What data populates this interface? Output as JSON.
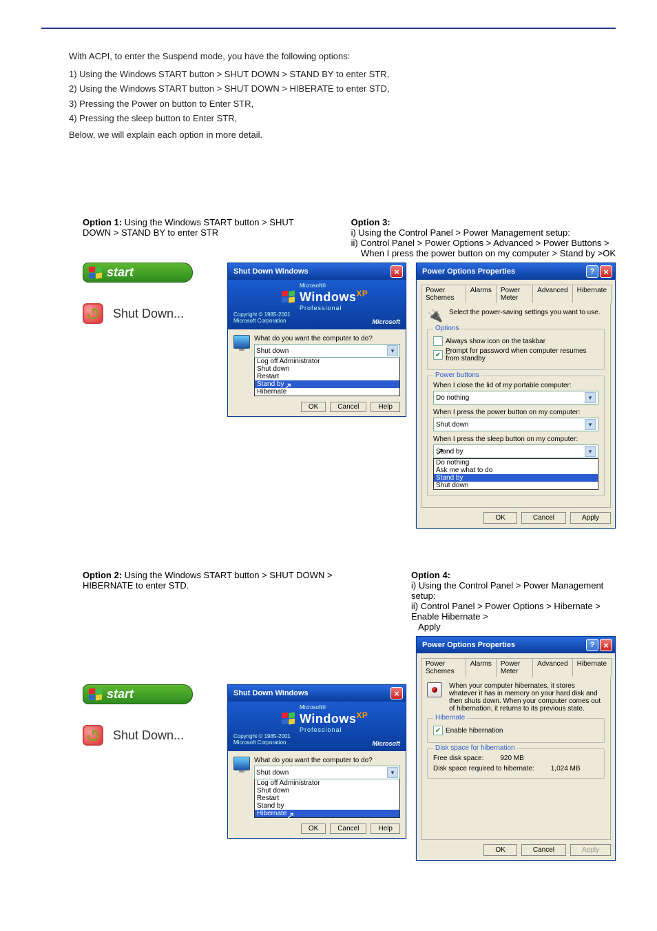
{
  "intro": {
    "l1": "With ACPI, to enter the Suspend mode, you have the following options:",
    "i1": "1) Using the Windows START button > SHUT DOWN > STAND BY to enter STR,",
    "i2": "2) Using the Windows START button > SHUT DOWN > HIBERATE to enter STD,",
    "i3": "3) Pressing the Power on button to Enter STR,",
    "i4": "4) Pressing the sleep button to Enter STR,",
    "l2": "Below, we will explain each option in more detail."
  },
  "opt1": {
    "title": "Option 1:",
    "desc": "Using the Windows START button > SHUT DOWN > STAND BY to enter STR"
  },
  "start_label": "start",
  "shutdown_label": "Shut Down...",
  "shutdown_dialog": {
    "title": "Shut Down Windows",
    "copyright": "Copyright © 1985-2001\nMicrosoft Corporation",
    "ms": "Microsoft",
    "brand_small": "Microsoft®",
    "brand_big": "Windows",
    "brand_xp": "XP",
    "brand_prof": "Professional",
    "question": "What do you want the computer to do?",
    "selected": "Shut down",
    "list": [
      "Log off Administrator",
      "Shut down",
      "Restart",
      "Stand by",
      "Hibernate"
    ],
    "hi_standby_index": 3,
    "hi_hibernate_index": 4,
    "btn_ok": "OK",
    "btn_cancel": "Cancel",
    "btn_help": "Help"
  },
  "opt3": {
    "title": "Option 3:",
    "line1": "i) Using the Control Panel > Power Management setup:",
    "line2": "ii) Control Panel > Power Options > Advanced > Power Buttons >",
    "line3": "    When I press the power button on my computer > Stand by >OK"
  },
  "power_adv": {
    "title": "Power Options Properties",
    "tabs": [
      "Power Schemes",
      "Alarms",
      "Power Meter",
      "Advanced",
      "Hibernate"
    ],
    "active_tab": "Advanced",
    "desc": "Select the power-saving settings you want to use.",
    "group_options": "Options",
    "opt_taskbar": "Always show icon on the taskbar",
    "opt_prompt": "Prompt for password when computer resumes from standby",
    "group_power": "Power buttons",
    "q_lid": "When I close the lid of my portable computer:",
    "v_lid": "Do nothing",
    "q_power": "When I press the power button on my computer:",
    "v_power": "Shut down",
    "q_sleep": "When I press the sleep button on my computer:",
    "v_sleep": "Stand by",
    "sleep_options": [
      "Do nothing",
      "Ask me what to do",
      "Stand by",
      "Shut down"
    ],
    "btn_ok": "OK",
    "btn_cancel": "Cancel",
    "btn_apply": "Apply"
  },
  "opt2": {
    "title": "Option 2:",
    "desc": "Using the Windows START button > SHUT DOWN > HIBERNATE to enter STD."
  },
  "opt4": {
    "title": "Option 4:",
    "line1": "i) Using the Control Panel > Power Management setup:",
    "line2": "ii) Control Panel > Power Options > Hibernate > Enable Hibernate >",
    "line3": "   Apply"
  },
  "power_hib": {
    "title": "Power Options Properties",
    "tabs": [
      "Power Schemes",
      "Alarms",
      "Power Meter",
      "Advanced",
      "Hibernate"
    ],
    "active_tab": "Hibernate",
    "desc": "When your computer hibernates, it stores whatever it has in memory on your hard disk and then shuts down. When your computer comes out of hibernation, it returns to its previous state.",
    "group_hib": "Hibernate",
    "enable": "Enable hibernation",
    "group_disk": "Disk space for hibernation",
    "free_label": "Free disk space:",
    "free_val": "920 MB",
    "req_label": "Disk space required to hibernate:",
    "req_val": "1,024 MB",
    "btn_ok": "OK",
    "btn_cancel": "Cancel",
    "btn_apply": "Apply"
  }
}
